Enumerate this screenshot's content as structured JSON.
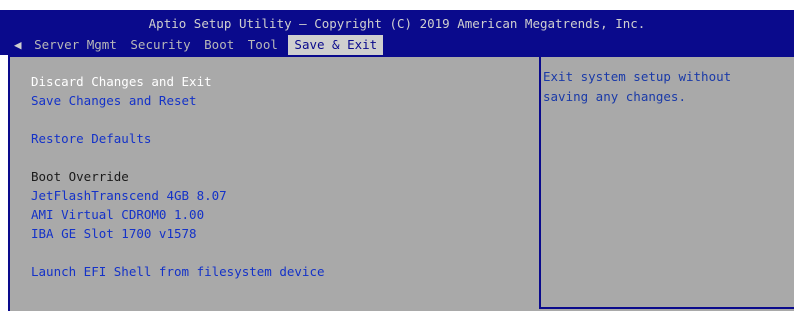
{
  "title": "Aptio Setup Utility – Copyright (C) 2019 American Megatrends, Inc.",
  "tabs": [
    {
      "label": "Server Mgmt"
    },
    {
      "label": "Security"
    },
    {
      "label": "Boot"
    },
    {
      "label": "Tool"
    },
    {
      "label": "Save & Exit",
      "active": true
    }
  ],
  "menu": {
    "discard_exit": "Discard Changes and Exit",
    "save_reset": "Save Changes and Reset",
    "restore_defaults": "Restore Defaults",
    "boot_override_heading": "Boot Override",
    "boot_devices": [
      "JetFlashTranscend 4GB 8.07",
      "AMI Virtual CDROM0 1.00",
      "IBA GE Slot 1700 v1578"
    ],
    "launch_efi": "Launch EFI Shell from filesystem device"
  },
  "help": {
    "line1": "Exit system setup without",
    "line2": "saving any changes."
  },
  "colors": {
    "header_bg": "#0a0a8c",
    "panel_bg": "#a9a9a9",
    "link": "#1432c8",
    "selected": "#ffffff"
  }
}
